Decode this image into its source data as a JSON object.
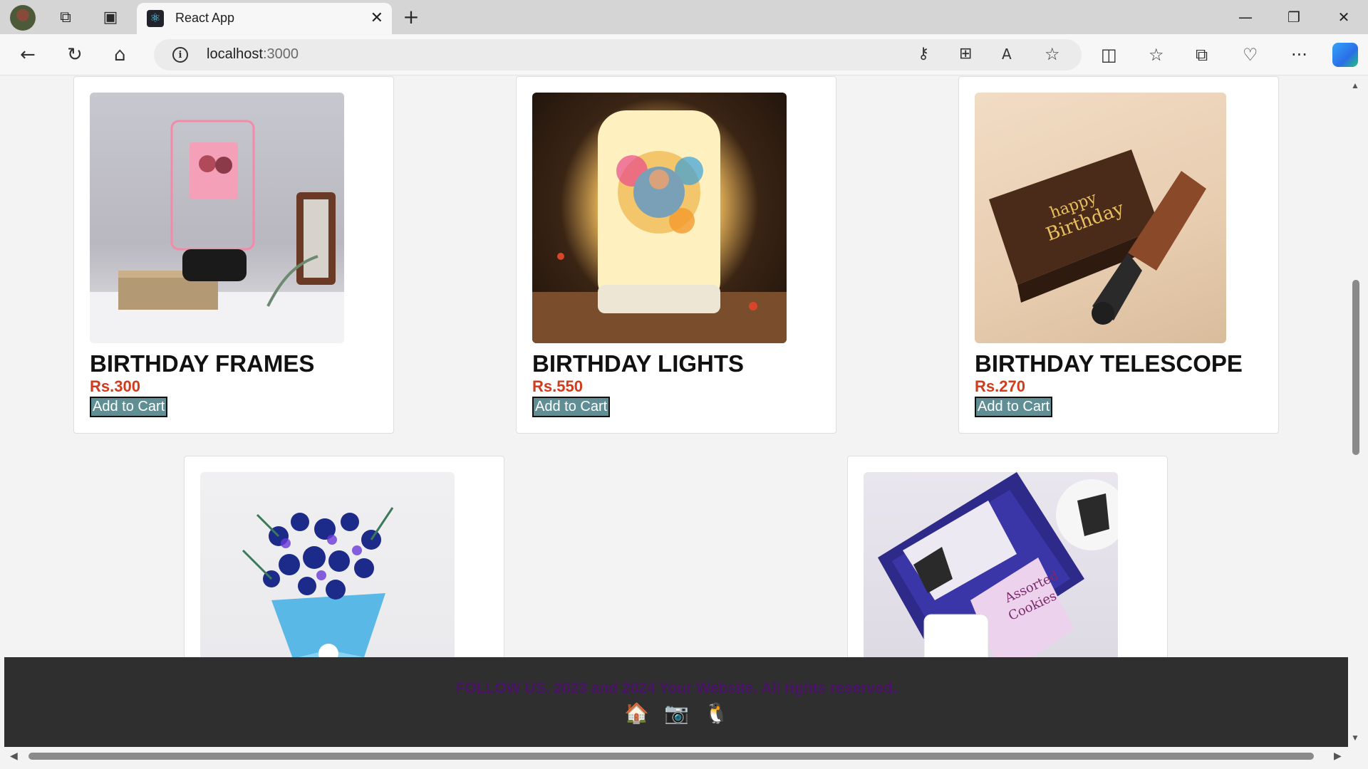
{
  "browser": {
    "tab_title": "React App",
    "tab_favicon": "react-logo-icon",
    "url_host": "localhost",
    "url_port": ":3000"
  },
  "products": [
    {
      "name": "BIRTHDAY FRAMES",
      "price": "Rs.300",
      "button": "Add to Cart",
      "image": "led-photo-frame"
    },
    {
      "name": "BIRTHDAY LIGHTS",
      "price": "Rs.550",
      "button": "Add to Cart",
      "image": "photo-lamp"
    },
    {
      "name": "BIRTHDAY TELESCOPE",
      "price": "Rs.270",
      "button": "Add to Cart",
      "image": "telescope-box"
    },
    {
      "name": "",
      "price": "",
      "button": "",
      "image": "blue-orchid-bouquet"
    },
    {
      "name": "",
      "price": "",
      "button": "",
      "image": "gift-hamper"
    }
  ],
  "footer": {
    "text": "FOLLOW US. 2023 and 2024 Your Website. All rights reserved.",
    "icons": [
      "house-icon",
      "camera-icon",
      "penguin-icon"
    ]
  },
  "colors": {
    "price": "#d23b1c",
    "button_bg": "#5f8f95",
    "footer_bg": "#2f2f2f",
    "footer_text": "#4a1466"
  }
}
